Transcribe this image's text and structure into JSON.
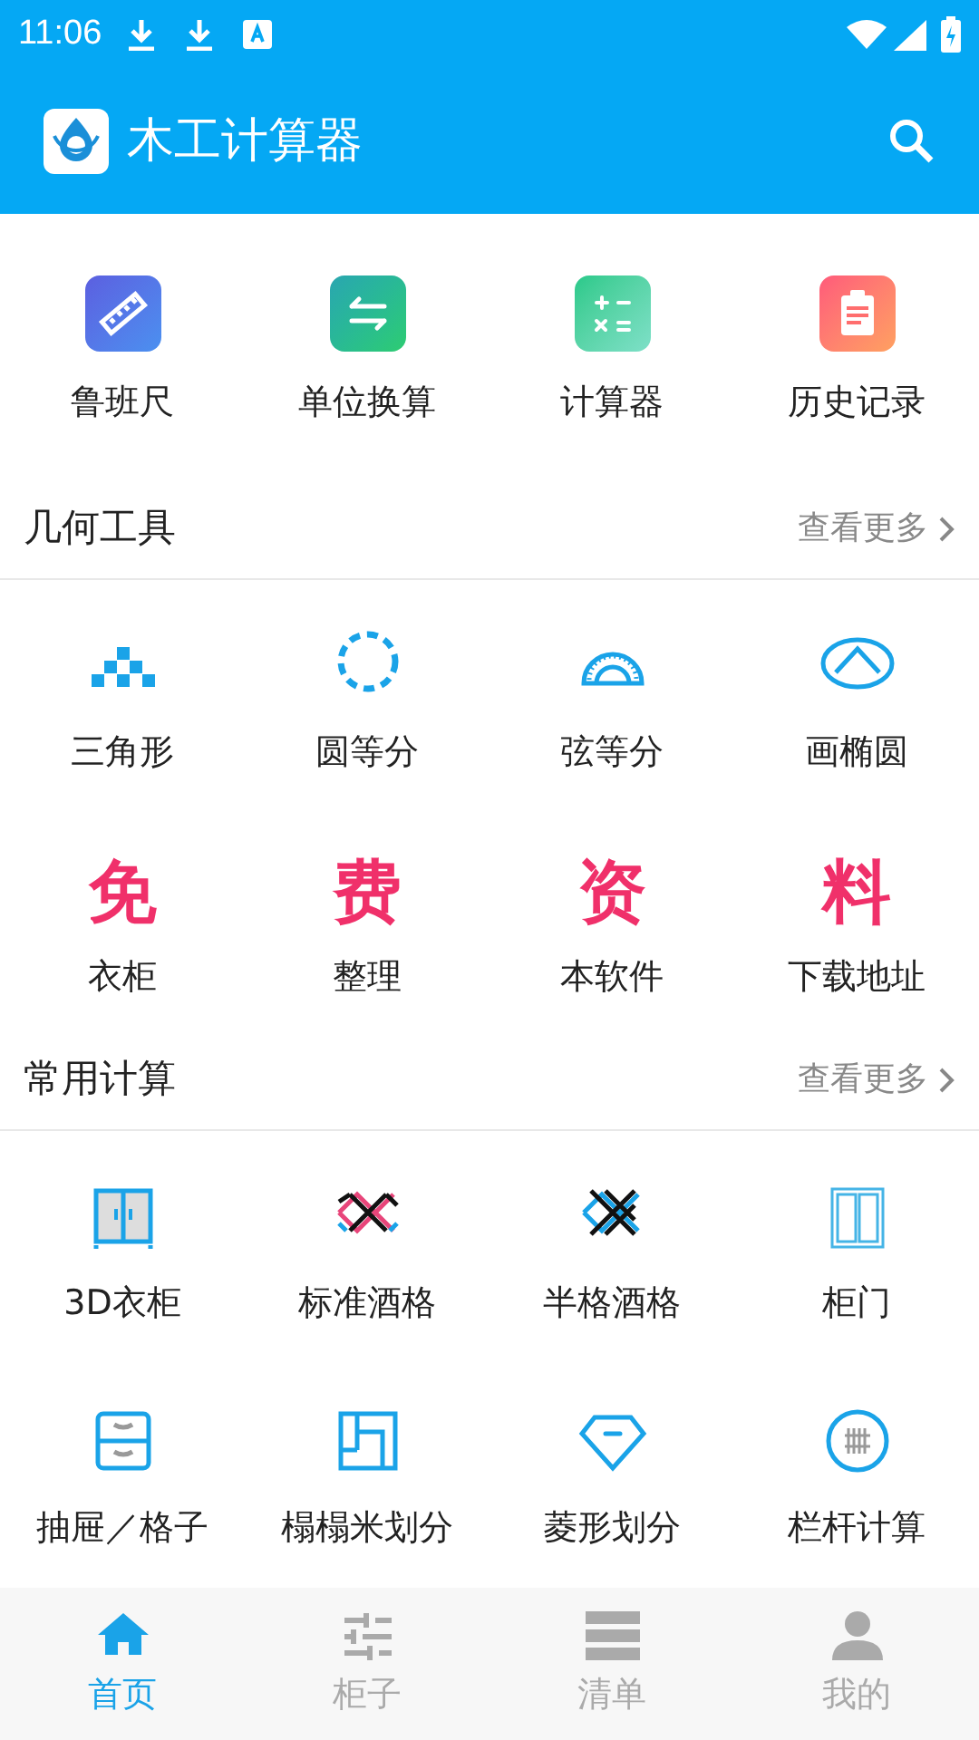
{
  "status_bar": {
    "time": "11:06"
  },
  "app_bar": {
    "title": "木工计算器"
  },
  "top_tools": [
    {
      "label": "鲁班尺"
    },
    {
      "label": "单位换算"
    },
    {
      "label": "计算器"
    },
    {
      "label": "历史记录"
    }
  ],
  "sections": [
    {
      "title": "几何工具",
      "more": "查看更多",
      "items": [
        {
          "kind": "icon",
          "label": "三角形"
        },
        {
          "kind": "icon",
          "label": "圆等分"
        },
        {
          "kind": "icon",
          "label": "弦等分"
        },
        {
          "kind": "icon",
          "label": "画椭圆"
        },
        {
          "kind": "glyph",
          "glyph": "免",
          "label": "衣柜"
        },
        {
          "kind": "glyph",
          "glyph": "费",
          "label": "整理"
        },
        {
          "kind": "glyph",
          "glyph": "资",
          "label": "本软件"
        },
        {
          "kind": "glyph",
          "glyph": "料",
          "label": "下载地址"
        }
      ]
    },
    {
      "title": "常用计算",
      "more": "查看更多",
      "items": [
        {
          "kind": "icon",
          "label": "3D衣柜"
        },
        {
          "kind": "icon",
          "label": "标准酒格"
        },
        {
          "kind": "icon",
          "label": "半格酒格"
        },
        {
          "kind": "icon",
          "label": "柜门"
        },
        {
          "kind": "icon",
          "label": "抽屉／格子"
        },
        {
          "kind": "icon",
          "label": "榻榻米划分"
        },
        {
          "kind": "icon",
          "label": "菱形划分"
        },
        {
          "kind": "icon",
          "label": "栏杆计算"
        }
      ]
    }
  ],
  "tabs": [
    {
      "label": "首页",
      "selected": true
    },
    {
      "label": "柜子",
      "selected": false
    },
    {
      "label": "清单",
      "selected": false
    },
    {
      "label": "我的",
      "selected": false
    }
  ]
}
